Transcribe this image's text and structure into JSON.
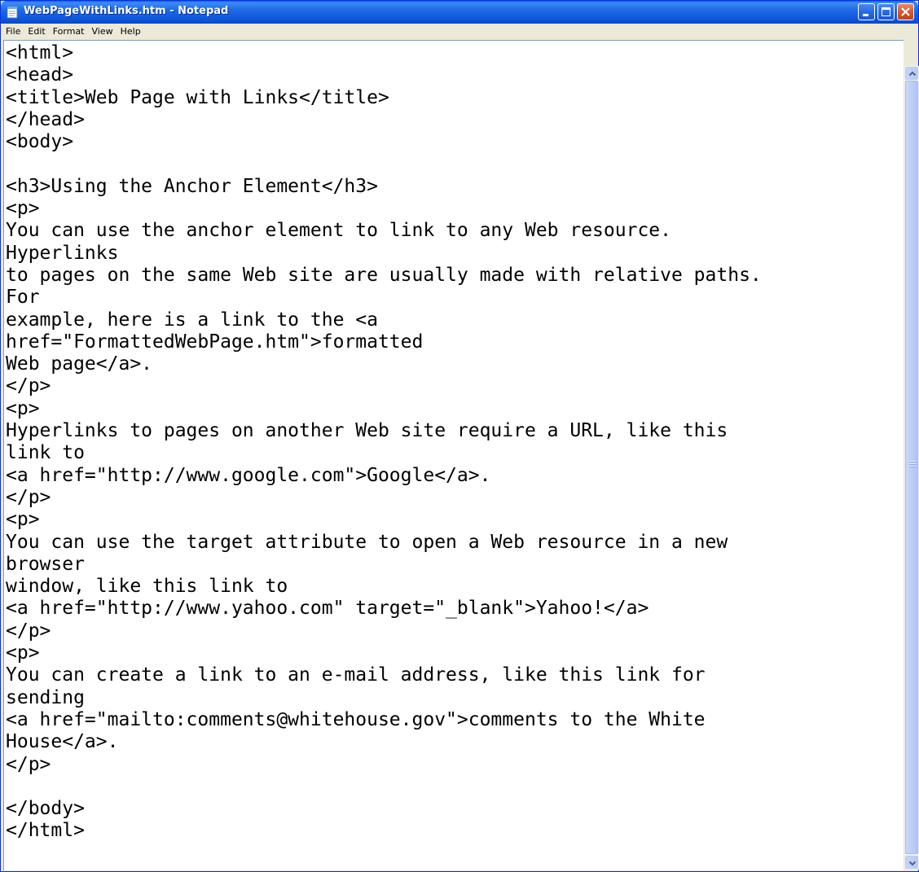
{
  "window": {
    "title": "WebPageWithLinks.htm - Notepad",
    "accent_color": "#0a53d8",
    "icons": {
      "app": "notepad-icon",
      "minimize": "minimize-icon",
      "maximize": "maximize-icon",
      "close": "close-icon"
    }
  },
  "menu": [
    "File",
    "Edit",
    "Format",
    "View",
    "Help"
  ],
  "editor": {
    "lines": [
      "<html>",
      "<head>",
      "<title>Web Page with Links</title>",
      "</head>",
      "<body>",
      "",
      "<h3>Using the Anchor Element</h3>",
      "<p>",
      "You can use the anchor element to link to any Web resource.",
      "Hyperlinks",
      "to pages on the same Web site are usually made with relative paths.",
      "For",
      "example, here is a link to the <a",
      "href=\"FormattedWebPage.htm\">formatted",
      "Web page</a>.",
      "</p>",
      "<p>",
      "Hyperlinks to pages on another Web site require a URL, like this",
      "link to",
      "<a href=\"http://www.google.com\">Google</a>.",
      "</p>",
      "<p>",
      "You can use the target attribute to open a Web resource in a new",
      "browser",
      "window, like this link to",
      "<a href=\"http://www.yahoo.com\" target=\"_blank\">Yahoo!</a>",
      "</p>",
      "<p>",
      "You can create a link to an e-mail address, like this link for",
      "sending",
      "<a href=\"mailto:comments@whitehouse.gov\">comments to the White",
      "House</a>.",
      "</p>",
      "",
      "</body>",
      "</html>"
    ]
  },
  "scrollbar": {
    "up_icon": "scroll-up-arrow-icon",
    "down_icon": "scroll-down-arrow-icon"
  }
}
